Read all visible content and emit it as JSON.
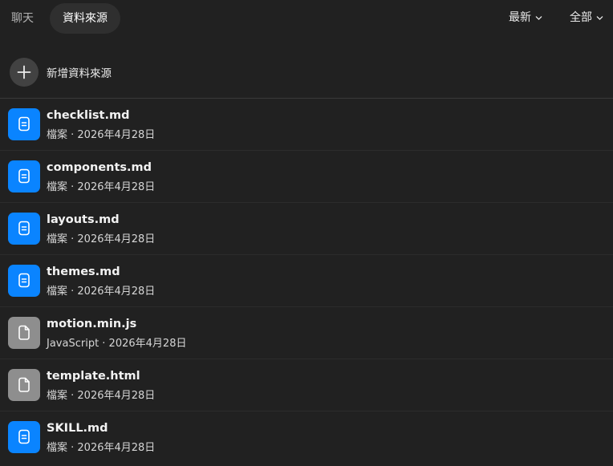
{
  "tabs": {
    "chat": "聊天",
    "sources": "資料來源"
  },
  "filters": {
    "sort": "最新",
    "type": "全部"
  },
  "add_source": {
    "label": "新增資料來源",
    "icon": "plus-icon"
  },
  "colors": {
    "doc_blue": "#0a84ff",
    "file_gray": "#8e8e8e"
  },
  "files": [
    {
      "name": "checklist.md",
      "meta": "檔案 · 2026年4月28日",
      "kind": "doc"
    },
    {
      "name": "components.md",
      "meta": "檔案 · 2026年4月28日",
      "kind": "doc"
    },
    {
      "name": "layouts.md",
      "meta": "檔案 · 2026年4月28日",
      "kind": "doc"
    },
    {
      "name": "themes.md",
      "meta": "檔案 · 2026年4月28日",
      "kind": "doc"
    },
    {
      "name": "motion.min.js",
      "meta": "JavaScript · 2026年4月28日",
      "kind": "file"
    },
    {
      "name": "template.html",
      "meta": "檔案 · 2026年4月28日",
      "kind": "file"
    },
    {
      "name": "SKILL.md",
      "meta": "檔案 · 2026年4月28日",
      "kind": "doc"
    }
  ]
}
